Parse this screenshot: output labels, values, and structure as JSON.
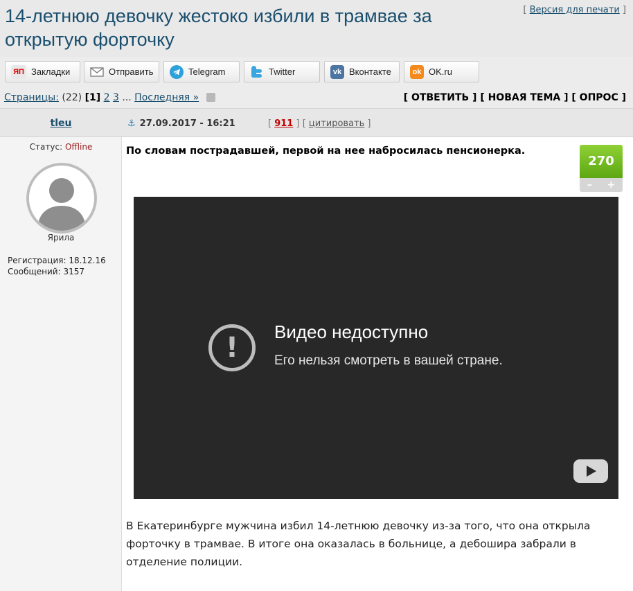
{
  "page_title": "14-летнюю девочку жестоко избили в трамвае за открытую форточку",
  "print_link": "Версия для печати",
  "share": [
    {
      "label": "Закладки",
      "icon": "yandex-icon"
    },
    {
      "label": "Отправить",
      "icon": "mail-icon"
    },
    {
      "label": "Telegram",
      "icon": "telegram-icon"
    },
    {
      "label": "Twitter",
      "icon": "twitter-icon"
    },
    {
      "label": "Вконтакте",
      "icon": "vk-icon"
    },
    {
      "label": "OK.ru",
      "icon": "ok-icon"
    }
  ],
  "icon_glyphs": {
    "yandex": "ЯП",
    "vk": "vk",
    "ok": "ok"
  },
  "pagination": {
    "label": "Страницы:",
    "count": "(22)",
    "current": "[1]",
    "page2": "2",
    "page3": "3",
    "ellipsis": "...",
    "last": "Последняя »"
  },
  "actions": {
    "reply": "[ ОТВЕТИТЬ ]",
    "new_topic": "[ НОВАЯ ТЕМА ]",
    "poll": "[ ОПРОС ]"
  },
  "post": {
    "author": "tleu",
    "datetime": "27.09.2017 - 16:21",
    "count": "911",
    "cite": "цитировать",
    "status_label": "Статус:",
    "status_value": "Offline",
    "rank": "Ярила",
    "registration": "Регистрация: 18.12.16",
    "messages": "Сообщений: 3157",
    "lead": "По словам пострадавшей, первой на нее набросилась пенсионерка.",
    "rating": "270",
    "rating_minus": "–",
    "rating_plus": "+",
    "video_title": "Видео недоступно",
    "video_subtitle": "Его нельзя смотреть в вашей стране.",
    "video_warn_glyph": "!",
    "body": "В Екатеринбурге мужчина избил 14-летнюю девочку из-за того, что она открыла форточку в трамвае. В итоге она оказалась в больнице, а дебошира забрали в отделение полиции."
  },
  "colors": {
    "title_blue": "#1a4f6e",
    "offline_red": "#9a1b1b",
    "count_red": "#c00000",
    "rating_green": "#5ca712",
    "video_bg": "#282828"
  }
}
